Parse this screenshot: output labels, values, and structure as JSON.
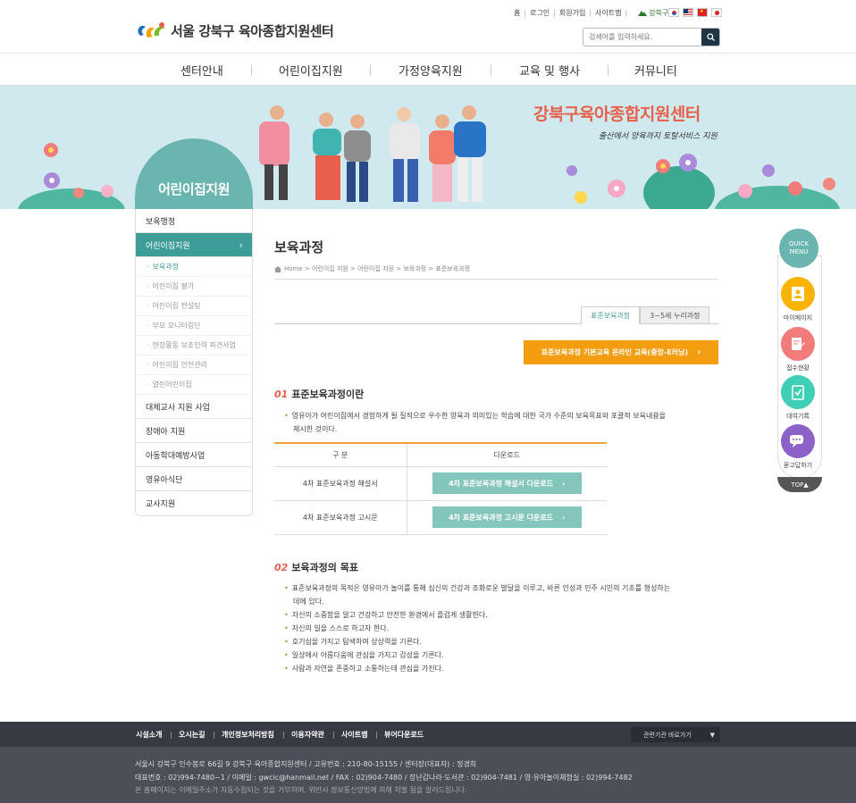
{
  "header": {
    "logo_text": "서울 강북구 육아종합지원센터",
    "util_links": [
      "홈",
      "로그인",
      "회원가입",
      "사이트맵"
    ],
    "gu_label": "강북구청",
    "search_placeholder": "검색어를 입력하세요."
  },
  "gnb": [
    "센터안내",
    "어린이집지원",
    "가정양육지원",
    "교육 및 행사",
    "커뮤니티"
  ],
  "banner": {
    "title": "강북구육아종합지원센터",
    "subtitle": "출산에서 양육까지 토탈서비스 지원"
  },
  "sidebar": {
    "title": "어린이집지원",
    "items": [
      {
        "label": "보육행정"
      },
      {
        "label": "어린이집지원",
        "active": true
      },
      {
        "label": "대체교사 지원 사업"
      },
      {
        "label": "장애아 지원"
      },
      {
        "label": "아동학대예방사업"
      },
      {
        "label": "영유아식단"
      },
      {
        "label": "교사지원"
      }
    ],
    "subitems": [
      "보육과정",
      "어린이집 평가",
      "어린이집 컨설팅",
      "부모 모니터링단",
      "현장활동 보조인력 파견사업",
      "어린이집 안전관리",
      "열린어린이집"
    ]
  },
  "content": {
    "page_title": "보육과정",
    "breadcrumb": "Home > 어린이집 지원 > 어린이집 지원 > 보육과정 > 표준보육과정",
    "tabs": [
      "표준보육과정",
      "3~5세 누리과정"
    ],
    "orange_button": "표준보육과정 기본교육 온라인 교육(중앙-E러닝)",
    "sec1": {
      "num": "01",
      "title": "표준보육과정이란",
      "text_1": "영유아가 어린이집에서 경험하게 될 질적으로 우수한 양육과 의미있는 학습에 대한 국가 수준의 보육목표와 포괄적 보육내용을",
      "text_2": "제시한 것이다."
    },
    "table": {
      "headers": [
        "구 분",
        "다운로드"
      ],
      "rows": [
        {
          "label": "4차 표준보육과정 해설서",
          "button": "4차 표준보육과정 해설서 다운로드"
        },
        {
          "label": "4차 표준보육과정 고시문",
          "button": "4차 표준보육과정 고시문 다운로드"
        }
      ]
    },
    "sec2": {
      "num": "02",
      "title": "보육과정의 목표",
      "first_1": "표준보육과정의 목적은 영유아가 놀이를 통해 심신의 건강과 조화로운 발달을 이루고, 바른 인성과 민주 시민의 기초를 형성하는",
      "first_2": "데에 있다.",
      "bullets": [
        "자신의 소중함을 알고 건강하고 안전한 환경에서 즐겁게 생활한다.",
        "자신의 일을 스스로 하고자 한다.",
        "호기심을 가지고 탐색하며 상상력을 기른다.",
        "일상에서 아름다움에 관심을 가지고 감성을 기른다.",
        "사람과 자연을 존중하고 소통하는데 관심을 가진다."
      ]
    }
  },
  "quick": {
    "head_1": "QUICK",
    "head_2": "MENU",
    "items": [
      {
        "label": "마이페이지",
        "color": "#f8b400"
      },
      {
        "label": "접수현황",
        "color": "#f27b7b"
      },
      {
        "label": "대여기록",
        "color": "#3fcfb7"
      },
      {
        "label": "묻고답하기",
        "color": "#8c62c9"
      }
    ],
    "top": "TOP▲"
  },
  "footer": {
    "links": [
      "시설소개",
      "오시는길",
      "개인정보처리방침",
      "이용자약관",
      "사이트맵",
      "뷰어다운로드"
    ],
    "related": "관련기관 바로가기",
    "line1": "서울시 강북구 인수봉로 66길 9 강북구 육아종합지원센터 / 고유번호 : 210-80-15155 / 센터장(대표자) : 정경희",
    "line2": "대표번호 : 02)994-7480~1 / 이메일 : gwcic@hanmail.net / FAX : 02)904-7480 / 장난감나라·도서관 : 02)904-7481 / 영·유아놀이체험실 : 02)994-7482",
    "line3": "본 홈페이지는 이메일주소가 자동수집되는 것을 거부하며, 위반시 정보통신망법에 의해 처벌 됨을 알려드립니다."
  }
}
